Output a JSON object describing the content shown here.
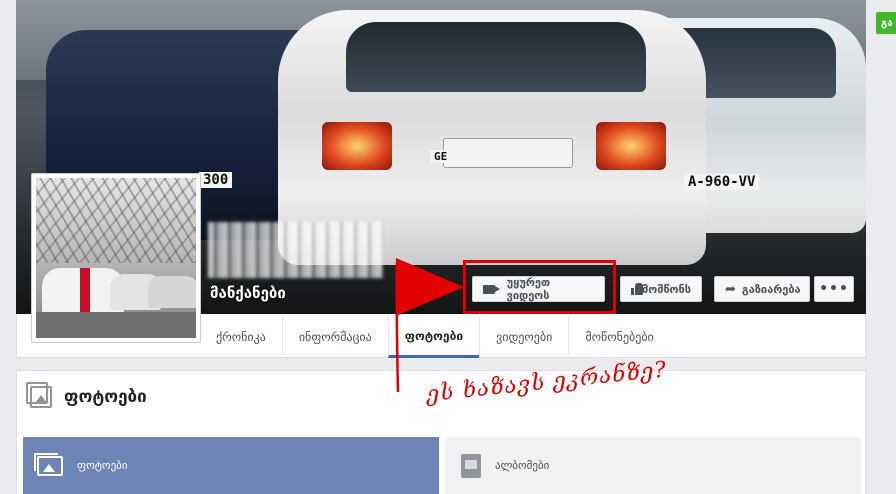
{
  "page": {
    "category": "მანქანები",
    "name_obscured": true
  },
  "cover": {
    "plate_left": "300",
    "plate_center": "GE",
    "plate_right": "A-960-VV",
    "buttons": {
      "watch_video": "უყურეთ ვიდეოს",
      "like": "მომწონს",
      "share": "გაზიარება",
      "more": "•••"
    }
  },
  "tabs": [
    {
      "label": "ქრონიკა",
      "active": false
    },
    {
      "label": "ინფორმაცია",
      "active": false
    },
    {
      "label": "ფოტოები",
      "active": true
    },
    {
      "label": "ვიდეოები",
      "active": false
    },
    {
      "label": "მოწონებები",
      "active": false
    }
  ],
  "photos_section": {
    "title": "ფოტოები",
    "subtabs": {
      "photos": "ფოტოები",
      "albums": "ალბომები"
    }
  },
  "right_edge_button": "გა",
  "annotation": {
    "handwritten_text": "ეს ხაზავს ეკრანზე?",
    "color": "#e00000"
  },
  "colors": {
    "facebook_blue": "#4267b2",
    "subtab_active_bg": "#6d84b4",
    "page_bg": "#e9ebee",
    "annotation_red": "#e00000",
    "green_button": "#42b72a"
  }
}
